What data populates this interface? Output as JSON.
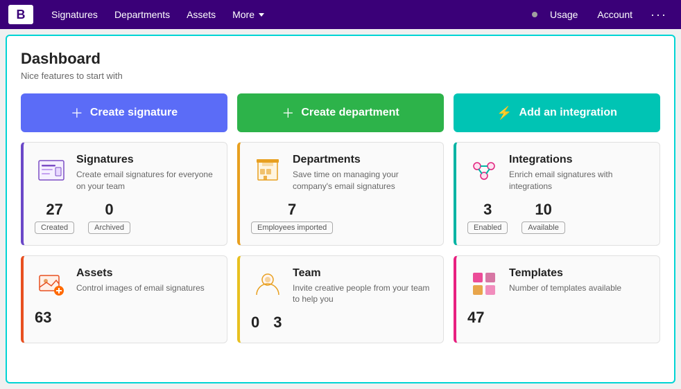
{
  "nav": {
    "logo": "B",
    "links": [
      {
        "label": "Signatures",
        "id": "signatures"
      },
      {
        "label": "Departments",
        "id": "departments"
      },
      {
        "label": "Assets",
        "id": "assets"
      },
      {
        "label": "More",
        "id": "more",
        "hasArrow": true
      }
    ],
    "right": [
      {
        "label": "Usage",
        "id": "usage"
      },
      {
        "label": "Account",
        "id": "account"
      }
    ],
    "more_dots": "···"
  },
  "dashboard": {
    "title": "Dashboard",
    "subtitle": "Nice features to start with"
  },
  "actions": [
    {
      "label": "Create signature",
      "id": "create-signature",
      "color": "blue"
    },
    {
      "label": "Create department",
      "id": "create-department",
      "color": "green"
    },
    {
      "label": "Add an integration",
      "id": "add-integration",
      "color": "teal"
    }
  ],
  "cards": [
    {
      "id": "signatures",
      "title": "Signatures",
      "desc": "Create email signatures for everyone on your team",
      "border": "signatures",
      "stats": [
        {
          "number": "27",
          "badge": "Created"
        },
        {
          "number": "0",
          "badge": "Archived"
        }
      ]
    },
    {
      "id": "departments",
      "title": "Departments",
      "desc": "Save time on managing your company's email signatures",
      "border": "departments",
      "stats": [
        {
          "number": "7",
          "badge": "Employees imported"
        }
      ]
    },
    {
      "id": "integrations",
      "title": "Integrations",
      "desc": "Enrich email signatures with integrations",
      "border": "integrations",
      "stats": [
        {
          "number": "3",
          "badge": "Enabled"
        },
        {
          "number": "10",
          "badge": "Available"
        }
      ]
    },
    {
      "id": "assets",
      "title": "Assets",
      "desc": "Control images of email signatures",
      "border": "assets",
      "stats": [
        {
          "number": "63",
          "badge": ""
        }
      ]
    },
    {
      "id": "team",
      "title": "Team",
      "desc": "Invite creative people from your team to help you",
      "border": "team",
      "stats": [
        {
          "number": "0",
          "badge": ""
        },
        {
          "number": "3",
          "badge": ""
        }
      ]
    },
    {
      "id": "templates",
      "title": "Templates",
      "desc": "Number of templates available",
      "border": "templates",
      "stats": [
        {
          "number": "47",
          "badge": ""
        }
      ]
    }
  ]
}
